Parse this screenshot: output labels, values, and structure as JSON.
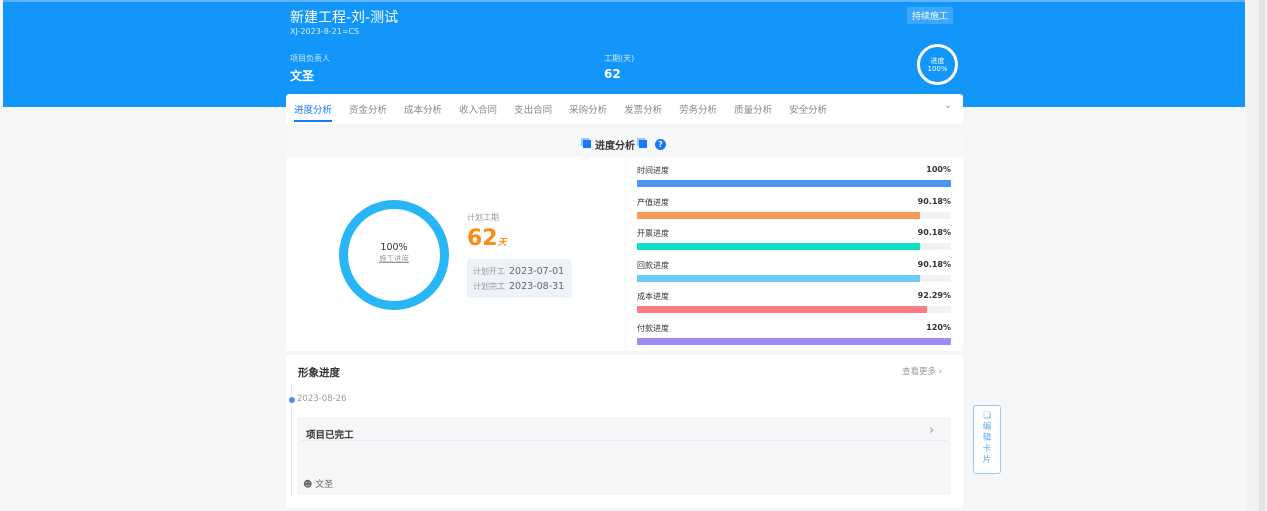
{
  "header": {
    "title": "新建工程-刘-测试",
    "code": "XJ-2023-8-21=CS",
    "status": "持续施工",
    "manager_label": "项目负责人",
    "manager": "文圣",
    "duration_label": "工期(天)",
    "duration": "62",
    "progress_label": "进度",
    "progress": "100%"
  },
  "tabs": [
    "进度分析",
    "资金分析",
    "成本分析",
    "收入合同",
    "支出合同",
    "采购分析",
    "发票分析",
    "劳务分析",
    "质量分析",
    "安全分析"
  ],
  "section": {
    "title": "进度分析",
    "help": "?"
  },
  "donut": {
    "percent": "100%",
    "label": "施工进度",
    "value": 100,
    "color": "#29b6f6"
  },
  "plan": {
    "label": "计划工期",
    "days": "62",
    "unit": "天",
    "start_label": "计划开工",
    "start": "2023-07-01",
    "end_label": "计划完工",
    "end": "2023-08-31"
  },
  "bars": [
    {
      "label": "时间进度",
      "text": "100%",
      "value": 100,
      "color": "#4e94f3"
    },
    {
      "label": "产值进度",
      "text": "90.18%",
      "value": 90.18,
      "color": "#f79a55"
    },
    {
      "label": "开票进度",
      "text": "90.18%",
      "value": 90.18,
      "color": "#0ee0c4"
    },
    {
      "label": "回款进度",
      "text": "90.18%",
      "value": 90.18,
      "color": "#6ccaf6"
    },
    {
      "label": "成本进度",
      "text": "92.29%",
      "value": 92.29,
      "color": "#fd7b84"
    },
    {
      "label": "付款进度",
      "text": "120%",
      "value": 120,
      "color": "#9b8ef5"
    }
  ],
  "image_progress": {
    "title": "形象进度",
    "more": "查看更多",
    "date": "2023-08-26",
    "card_title": "项目已完工",
    "user": "文圣"
  },
  "edit_card": [
    "编",
    "辑",
    "卡",
    "片"
  ]
}
